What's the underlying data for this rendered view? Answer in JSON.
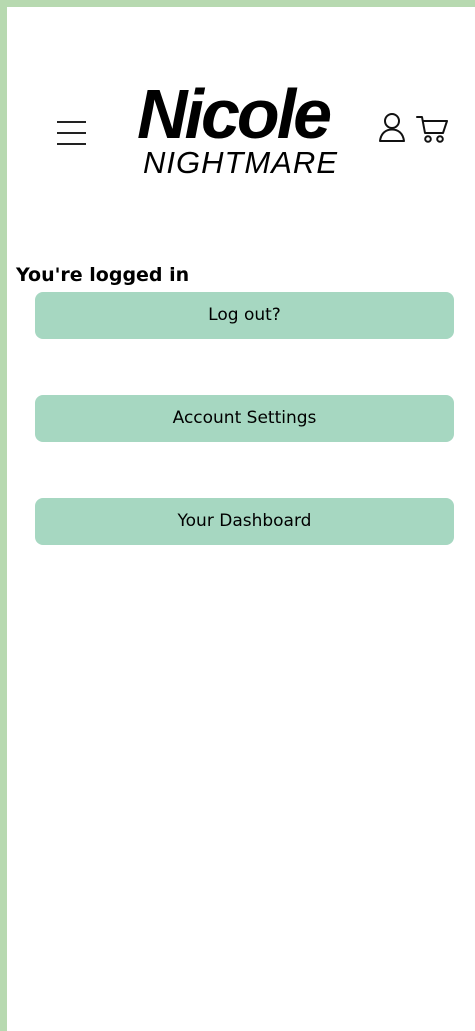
{
  "header": {
    "logo_main": "Nicole",
    "logo_sub": "NIGHTMARE",
    "icons": {
      "menu": "hamburger-menu-icon",
      "account": "user-icon",
      "cart": "shopping-cart-icon"
    }
  },
  "main": {
    "status_heading": "You're logged in",
    "buttons": {
      "logout": "Log out?",
      "account_settings": "Account Settings",
      "dashboard": "Your Dashboard"
    }
  },
  "colors": {
    "frame": "#b7d9b0",
    "button_bg": "#a6d7c1",
    "text": "#000000"
  }
}
